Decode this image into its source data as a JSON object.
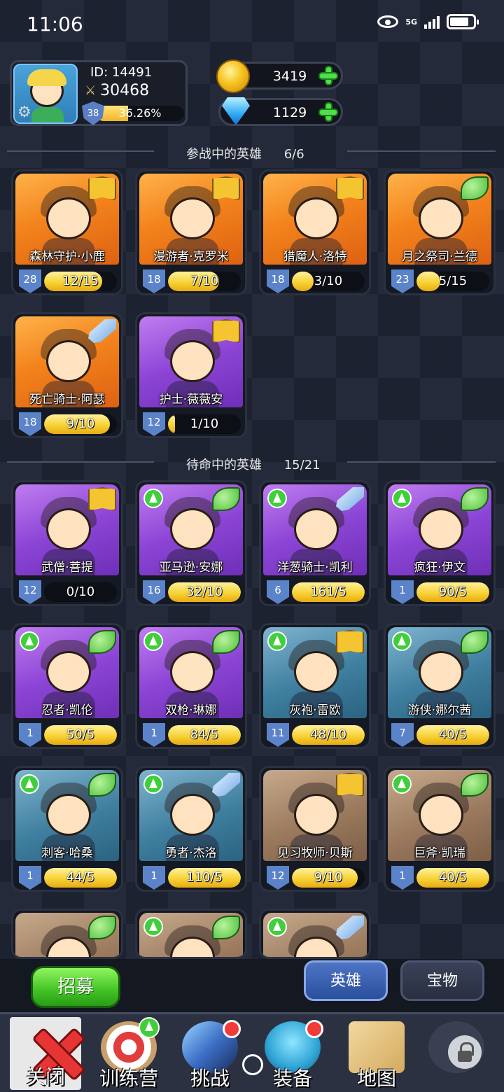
{
  "status_bar": {
    "time": "11:06",
    "network": "5G"
  },
  "profile": {
    "id_text": "ID:  14491",
    "power": "30468",
    "level": "38",
    "exp_percent_text": "36.26%",
    "exp_fraction": 0.3626
  },
  "currency": {
    "gold": "3419",
    "gems": "1129"
  },
  "deployed_section": {
    "title": "参战中的英雄",
    "count": "6/6"
  },
  "standby_section": {
    "title": "待命中的英雄",
    "count": "15/21"
  },
  "deployed_heroes": [
    {
      "name": "森林守护·小鹿",
      "level": "28",
      "progress": "12/15",
      "fill": 0.8,
      "bg": "orange",
      "badge": "book",
      "upgrade": false
    },
    {
      "name": "漫游者·克罗米",
      "level": "18",
      "progress": "7/10",
      "fill": 0.7,
      "bg": "orange",
      "badge": "book",
      "upgrade": false
    },
    {
      "name": "猎魔人·洛特",
      "level": "18",
      "progress": "3/10",
      "fill": 0.3,
      "bg": "orange",
      "badge": "book",
      "upgrade": false
    },
    {
      "name": "月之祭司·兰德",
      "level": "23",
      "progress": "5/15",
      "fill": 0.33,
      "bg": "orange",
      "badge": "leaf",
      "upgrade": false
    },
    {
      "name": "死亡骑士·阿瑟",
      "level": "18",
      "progress": "9/10",
      "fill": 0.9,
      "bg": "orange",
      "badge": "sword",
      "upgrade": false
    },
    {
      "name": "护士·薇薇安",
      "level": "12",
      "progress": "1/10",
      "fill": 0.1,
      "bg": "purple",
      "badge": "book",
      "upgrade": false
    }
  ],
  "standby_heroes": [
    {
      "name": "武僧·菩提",
      "level": "12",
      "progress": "0/10",
      "fill": 0,
      "bg": "purple",
      "badge": "book",
      "upgrade": false
    },
    {
      "name": "亚马逊·安娜",
      "level": "16",
      "progress": "32/10",
      "fill": 1,
      "bg": "purple",
      "badge": "leaf",
      "upgrade": true
    },
    {
      "name": "洋葱骑士·凯利",
      "level": "6",
      "progress": "161/5",
      "fill": 1,
      "bg": "purple",
      "badge": "sword",
      "upgrade": true
    },
    {
      "name": "疯狂·伊文",
      "level": "1",
      "progress": "90/5",
      "fill": 1,
      "bg": "purple",
      "badge": "leaf",
      "upgrade": true
    },
    {
      "name": "忍者·凯伦",
      "level": "1",
      "progress": "50/5",
      "fill": 1,
      "bg": "purple",
      "badge": "leaf",
      "upgrade": true
    },
    {
      "name": "双枪·琳娜",
      "level": "1",
      "progress": "84/5",
      "fill": 1,
      "bg": "purple",
      "badge": "leaf",
      "upgrade": true
    },
    {
      "name": "灰袍·雷欧",
      "level": "11",
      "progress": "48/10",
      "fill": 1,
      "bg": "teal",
      "badge": "book",
      "upgrade": true
    },
    {
      "name": "游侠·娜尔茜",
      "level": "7",
      "progress": "40/5",
      "fill": 1,
      "bg": "teal",
      "badge": "leaf",
      "upgrade": true
    },
    {
      "name": "刺客·哈桑",
      "level": "1",
      "progress": "44/5",
      "fill": 1,
      "bg": "teal",
      "badge": "leaf",
      "upgrade": true
    },
    {
      "name": "勇者·杰洛",
      "level": "1",
      "progress": "110/5",
      "fill": 1,
      "bg": "teal",
      "badge": "sword",
      "upgrade": true
    },
    {
      "name": "见习牧师·贝斯",
      "level": "12",
      "progress": "9/10",
      "fill": 0.9,
      "bg": "tan",
      "badge": "book",
      "upgrade": false
    },
    {
      "name": "巨斧·凯瑞",
      "level": "1",
      "progress": "40/5",
      "fill": 1,
      "bg": "tan",
      "badge": "leaf",
      "upgrade": true
    },
    {
      "name": "",
      "level": "",
      "progress": "",
      "fill": 0,
      "bg": "tan",
      "badge": "leaf",
      "upgrade": false
    },
    {
      "name": "",
      "level": "",
      "progress": "",
      "fill": 0,
      "bg": "tan",
      "badge": "leaf",
      "upgrade": true
    },
    {
      "name": "",
      "level": "",
      "progress": "",
      "fill": 0,
      "bg": "tan",
      "badge": "sword",
      "upgrade": true
    }
  ],
  "actions": {
    "recruit": "招募"
  },
  "tabs": [
    {
      "label": "英雄",
      "active": true
    },
    {
      "label": "宝物",
      "active": false
    }
  ],
  "nav": [
    {
      "label": "关闭",
      "icon": "close-icon"
    },
    {
      "label": "训练营",
      "icon": "target-icon"
    },
    {
      "label": "挑战",
      "icon": "sword-icon"
    },
    {
      "label": "装备",
      "icon": "armor-icon"
    },
    {
      "label": "地图",
      "icon": "map-icon"
    },
    {
      "label": "",
      "icon": "lock-icon"
    }
  ]
}
